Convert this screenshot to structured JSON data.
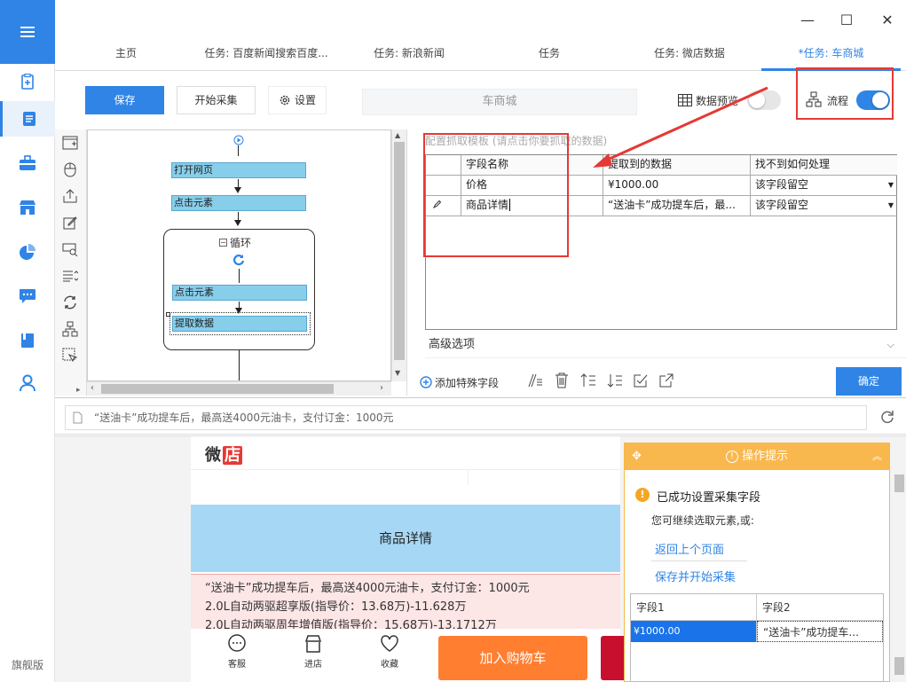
{
  "sidebar": {
    "items": [
      {
        "name": "new-task-icon"
      },
      {
        "name": "task-list-icon"
      },
      {
        "name": "toolbox-icon"
      },
      {
        "name": "store-icon"
      },
      {
        "name": "chart-icon"
      },
      {
        "name": "message-icon"
      },
      {
        "name": "book-icon"
      },
      {
        "name": "user-icon"
      }
    ],
    "edition": "旗舰版",
    "accent": "#2f84e6"
  },
  "window": {
    "minimize": "—",
    "maximize": "☐",
    "close": "✕"
  },
  "tabs": [
    {
      "label": "主页"
    },
    {
      "label": "任务: 百度新闻搜索百度..."
    },
    {
      "label": "任务: 新浪新闻"
    },
    {
      "label": "任务"
    },
    {
      "label": "任务: 微店数据"
    },
    {
      "label": "*任务: 车商城"
    }
  ],
  "toolbar": {
    "save": "保存",
    "start": "开始采集",
    "settings": "设置",
    "task_name": "车商城",
    "data_preview": "数据预览",
    "data_preview_on": false,
    "flow": "流程",
    "flow_on": true
  },
  "flow": {
    "open_page": "打开网页",
    "click1": "点击元素",
    "loop": "循环",
    "click2": "点击元素",
    "extract": "提取数据"
  },
  "fields": {
    "hint": "配置抓取模板 (请点击你要抓取的数据)",
    "headers": [
      "字段名称",
      "提取到的数据",
      "找不到如何处理"
    ],
    "rows": [
      {
        "name": "价格",
        "value": "¥1000.00",
        "action": "该字段留空"
      },
      {
        "name": "商品详情",
        "value": "“送油卡”成功提车后，最...",
        "action": "该字段留空"
      }
    ],
    "advanced": "高级选项",
    "add_special": "添加特殊字段",
    "confirm": "确定"
  },
  "address_bar": {
    "value": "“送油卡”成功提车后，最高送4000元油卡，支付订金：1000元"
  },
  "page": {
    "logo": "微店",
    "detail_title": "商品详情",
    "lines": [
      "“送油卡”成功提车后，最高送4000元油卡，支付订金：1000元",
      "2.0L自动两驱超享版(指导价：13.68万)-11.628万",
      "2.0L自动两驱周年增值版(指导价：15.68万)-13.1712万"
    ],
    "bottom": {
      "service": "客服",
      "shop": "进店",
      "favorite": "收藏",
      "add_cart": "加入购物车"
    }
  },
  "tips": {
    "title": "操作提示",
    "success": "已成功设置采集字段",
    "continue": "您可继续选取元素,或:",
    "back": "返回上个页面",
    "save_start": "保存并开始采集",
    "table_headers": [
      "字段1",
      "字段2"
    ],
    "table_row": [
      "¥1000.00",
      "“送油卡”成功提车..."
    ],
    "color": "#f9b84e"
  }
}
